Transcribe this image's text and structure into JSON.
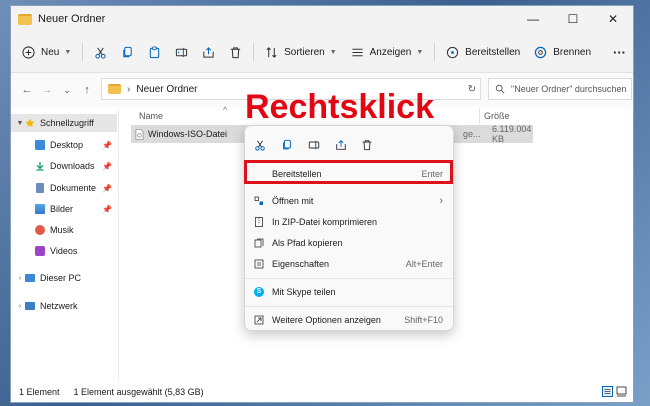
{
  "window": {
    "title": "Neuer Ordner",
    "minimize": "—",
    "maximize": "☐",
    "close": "✕"
  },
  "toolbar": {
    "new_label": "Neu",
    "sort_label": "Sortieren",
    "view_label": "Anzeigen",
    "provide_label": "Bereitstellen",
    "burn_label": "Brennen",
    "more": "···"
  },
  "address": {
    "back": "←",
    "forward": "→",
    "recent": "⌄",
    "up": "↑",
    "separator": "›",
    "path": "Neuer Ordner",
    "refresh": "↻",
    "search_placeholder": "\"Neuer Ordner\" durchsuchen"
  },
  "sidebar": {
    "quick_access": "Schnellzugriff",
    "items": [
      {
        "label": "Desktop"
      },
      {
        "label": "Downloads"
      },
      {
        "label": "Dokumente"
      },
      {
        "label": "Bilder"
      },
      {
        "label": "Musik"
      },
      {
        "label": "Videos"
      }
    ],
    "this_pc": "Dieser PC",
    "network": "Netzwerk",
    "pin": "📌"
  },
  "columns": {
    "name": "Name",
    "size": "Größe"
  },
  "file": {
    "name": "Windows-ISO-Datei",
    "type_partial": "ge...",
    "size": "6.119.004 KB"
  },
  "context_menu": {
    "items": [
      {
        "label": "Bereitstellen",
        "shortcut": "Enter"
      },
      {
        "label": "Öffnen mit",
        "shortcut": "›"
      },
      {
        "label": "In ZIP-Datei komprimieren",
        "shortcut": ""
      },
      {
        "label": "Als Pfad kopieren",
        "shortcut": ""
      },
      {
        "label": "Eigenschaften",
        "shortcut": "Alt+Enter"
      },
      {
        "label": "Mit Skype teilen",
        "shortcut": ""
      },
      {
        "label": "Weitere Optionen anzeigen",
        "shortcut": "Shift+F10"
      }
    ]
  },
  "overlay": {
    "text": "Rechtsklick"
  },
  "status": {
    "count": "1 Element",
    "selected": "1 Element ausgewählt (5,83 GB)"
  },
  "colors": {
    "accent": "#0067c0",
    "highlight": "#e0101a",
    "overlay": "#e30613"
  }
}
